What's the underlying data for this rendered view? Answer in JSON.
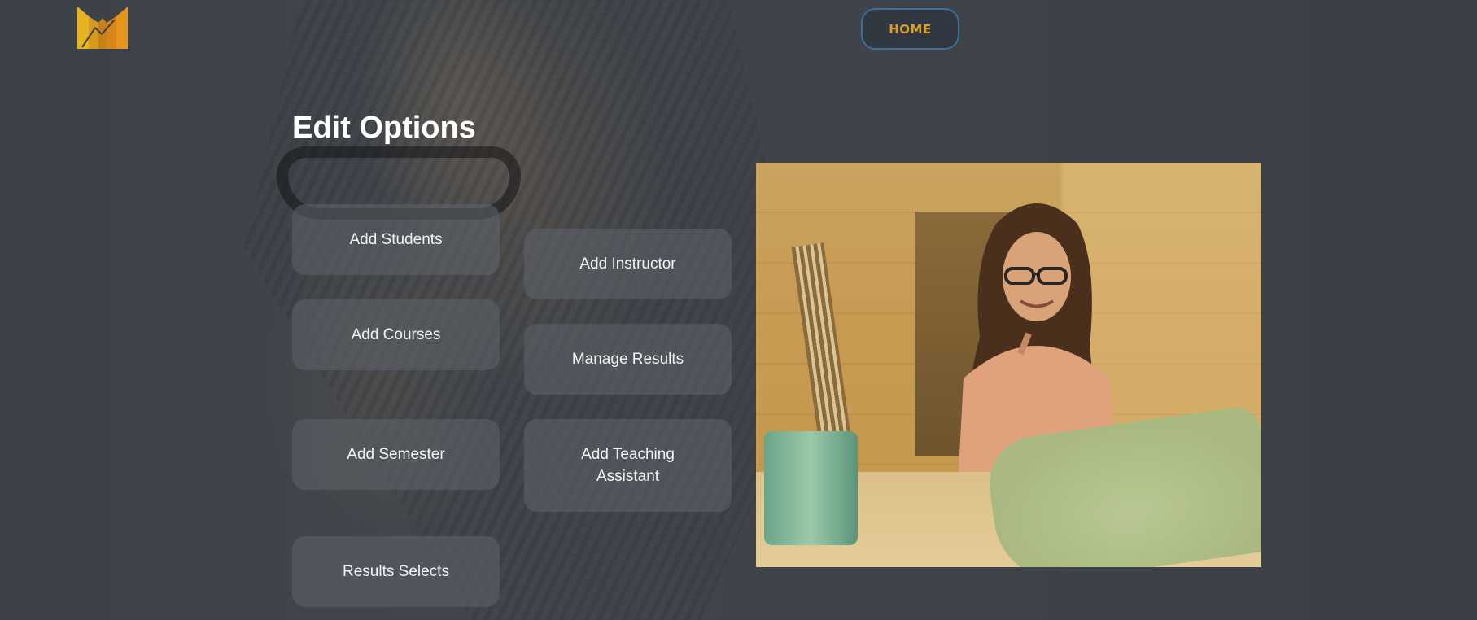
{
  "header": {
    "logo_icon": "bar-chart-logo-icon",
    "home_label": "HOME"
  },
  "main": {
    "title": "Edit Options",
    "options": [
      {
        "id": "add-students",
        "label": "Add Students"
      },
      {
        "id": "add-instructor",
        "label": "Add Instructor"
      },
      {
        "id": "add-courses",
        "label": "Add Courses"
      },
      {
        "id": "manage-results",
        "label": "Manage Results"
      },
      {
        "id": "add-semester",
        "label": "Add Semester"
      },
      {
        "id": "add-teaching-assistant",
        "label": "Add Teaching Assistant"
      },
      {
        "id": "results-selects",
        "label": "Results Selects"
      }
    ],
    "hero_image": "woman-painting-photo"
  },
  "colors": {
    "accent": "#d9a030",
    "home_border": "#3d6f9a",
    "background": "#3b4047",
    "button_bg": "#5f646c"
  }
}
